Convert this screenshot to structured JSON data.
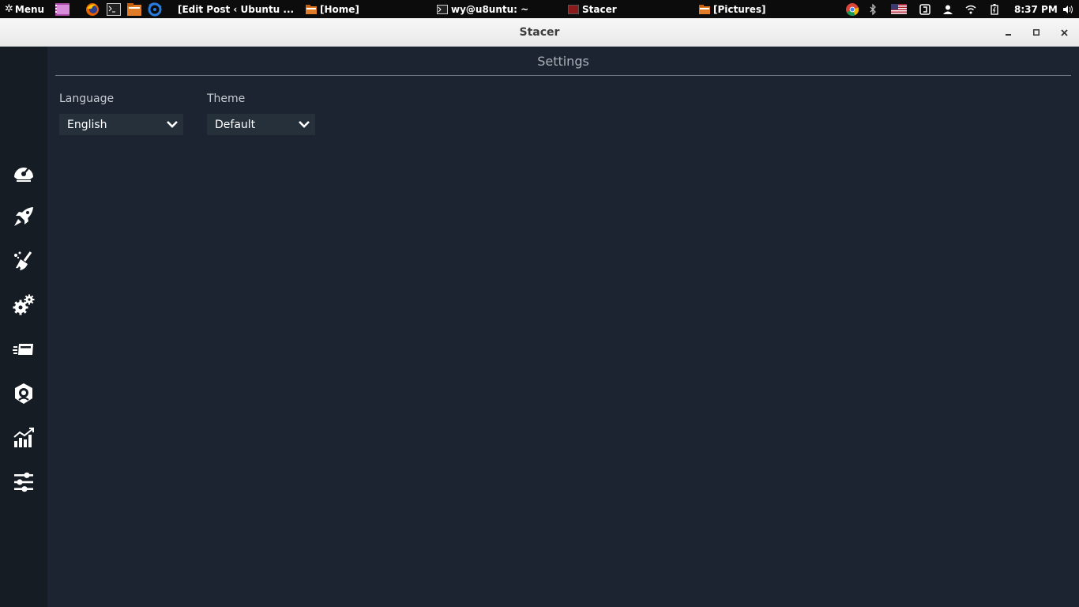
{
  "panel": {
    "menu_label": "Menu",
    "tasks": [
      {
        "label": "[Edit Post ‹ Ubuntu ...",
        "icon": "chrome-icon"
      },
      {
        "label": "[Home]",
        "icon": "folder-icon"
      },
      {
        "label": "wy@u8untu: ~",
        "icon": "terminal-icon"
      },
      {
        "label": "Stacer",
        "icon": "stacer-app-icon"
      },
      {
        "label": "[Pictures]",
        "icon": "folder-icon"
      }
    ],
    "clock": "8:37 PM"
  },
  "window": {
    "title": "Stacer"
  },
  "page": {
    "title": "Settings",
    "language": {
      "label": "Language",
      "value": "English"
    },
    "theme": {
      "label": "Theme",
      "value": "Default"
    }
  },
  "sidebar": {
    "items": [
      {
        "icon": "dashboard-icon"
      },
      {
        "icon": "startup-apps-icon"
      },
      {
        "icon": "system-cleaner-icon"
      },
      {
        "icon": "services-icon"
      },
      {
        "icon": "uninstaller-icon"
      },
      {
        "icon": "resources-icon"
      },
      {
        "icon": "resources-chart-icon"
      },
      {
        "icon": "settings-sliders-icon"
      }
    ]
  },
  "colors": {
    "background": "#1b2430",
    "sidebar": "#161c23",
    "select_bg": "#26303b",
    "panel": "#0c0c0c"
  }
}
